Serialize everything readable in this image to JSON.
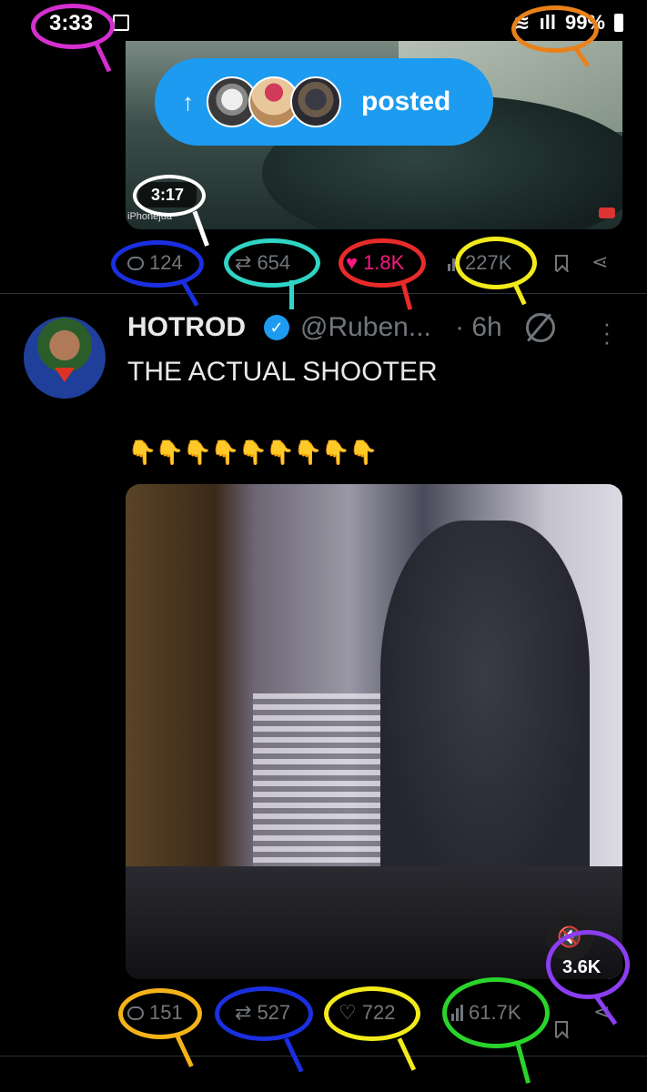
{
  "status_bar": {
    "time": "3:33",
    "battery": "99%"
  },
  "post1": {
    "video_duration": "3:17",
    "watermark": "iPhonejua",
    "posted_pill": {
      "text": "posted"
    },
    "actions": {
      "replies": "124",
      "reposts": "654",
      "likes": "1.8K",
      "views": "227K"
    }
  },
  "post2": {
    "name": "HOTROD",
    "handle": "@Ruben...",
    "time": "· 6h",
    "text": "THE ACTUAL SHOOTER",
    "emojis": "👇👇👇👇👇👇👇👇👇",
    "video_views": "3.6K",
    "actions": {
      "replies": "151",
      "reposts": "527",
      "likes": "722",
      "views": "61.7K"
    }
  },
  "colors": {
    "accent": "#1d9bf0",
    "like_active": "#f91880",
    "muted": "#71767b",
    "annotation_magenta": "#d42fd0",
    "annotation_orange": "#e8811a",
    "annotation_white": "#ffffff",
    "annotation_blue": "#1a2fe0",
    "annotation_teal": "#2fd4c4",
    "annotation_red": "#e82a2a",
    "annotation_yellow": "#f2ea1a",
    "annotation_purple": "#8a3ef0",
    "annotation_amber": "#f5b31a",
    "annotation_green": "#2ad42a"
  }
}
